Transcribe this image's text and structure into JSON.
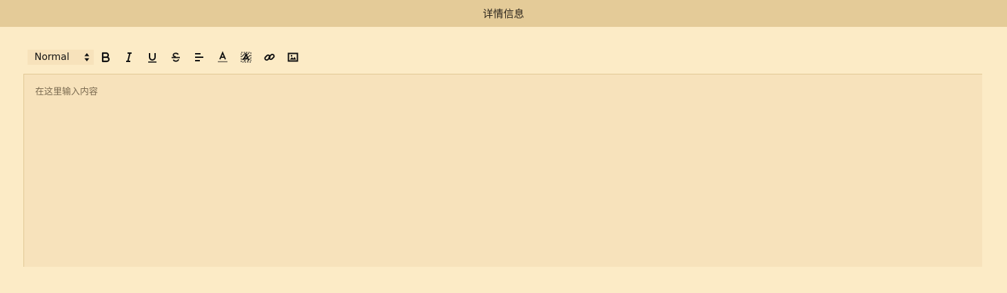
{
  "header": {
    "title": "详情信息"
  },
  "toolbar": {
    "format_select": {
      "value": "Normal"
    },
    "buttons": [
      {
        "name": "bold",
        "icon": "bold-icon"
      },
      {
        "name": "italic",
        "icon": "italic-icon"
      },
      {
        "name": "underline",
        "icon": "underline-icon"
      },
      {
        "name": "strike",
        "icon": "strikethrough-icon"
      },
      {
        "name": "align",
        "icon": "align-left-icon"
      },
      {
        "name": "color",
        "icon": "text-color-icon"
      },
      {
        "name": "background",
        "icon": "background-color-icon"
      },
      {
        "name": "link",
        "icon": "link-icon"
      },
      {
        "name": "image",
        "icon": "image-icon"
      }
    ]
  },
  "editor": {
    "placeholder": "在这里输入内容"
  },
  "colors": {
    "page_bg": "#fcebc6",
    "header_bg": "#e4cb98",
    "editor_bg": "#f7e2bb",
    "border": "#e1c896"
  }
}
